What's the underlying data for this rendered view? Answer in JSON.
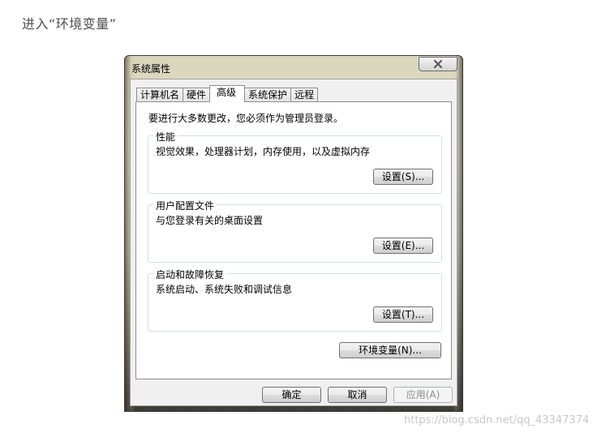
{
  "article": {
    "heading": "进入“环境变量”"
  },
  "window": {
    "title": "系统属性",
    "close_icon": "close-icon",
    "tabs": [
      {
        "label": "计算机名",
        "active": false
      },
      {
        "label": "硬件",
        "active": false
      },
      {
        "label": "高级",
        "active": true
      },
      {
        "label": "系统保护",
        "active": false
      },
      {
        "label": "远程",
        "active": false
      }
    ],
    "admin_note": "要进行大多数更改，您必须作为管理员登录。",
    "groups": [
      {
        "label": "性能",
        "description": "视觉效果，处理器计划，内存使用，以及虚拟内存",
        "button": "设置(S)..."
      },
      {
        "label": "用户配置文件",
        "description": "与您登录有关的桌面设置",
        "button": "设置(E)..."
      },
      {
        "label": "启动和故障恢复",
        "description": "系统启动、系统失败和调试信息",
        "button": "设置(T)..."
      }
    ],
    "env_button": "环境变量(N)...",
    "buttons": {
      "ok": "确定",
      "cancel": "取消",
      "apply": "应用(A)"
    }
  },
  "watermark": "https://blog.csdn.net/qq_43347374"
}
